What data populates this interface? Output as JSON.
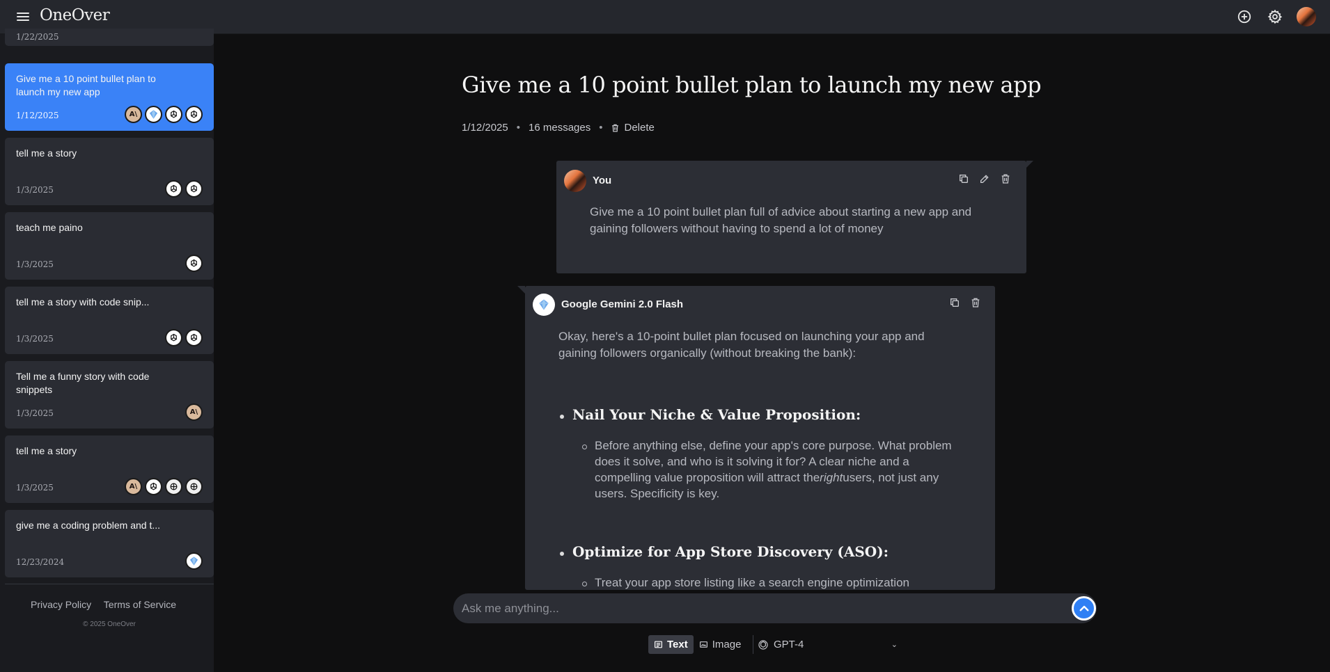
{
  "app": {
    "brand": "OneOver"
  },
  "sidebar": {
    "chats": [
      {
        "title": "",
        "date": "1/22/2025",
        "models": []
      },
      {
        "title": "Give me a 10 point bullet plan to launch my new app",
        "date": "1/12/2025",
        "models": [
          "anthropic-icon",
          "gemini-icon",
          "openai-icon",
          "openai-icon"
        ],
        "active": true
      },
      {
        "title": "tell me a story",
        "date": "1/3/2025",
        "models": [
          "openai-icon",
          "openai-icon"
        ]
      },
      {
        "title": "teach me paino",
        "date": "1/3/2025",
        "models": [
          "openai-icon"
        ]
      },
      {
        "title": "tell me a story with code snip...",
        "date": "1/3/2025",
        "models": [
          "openai-icon",
          "openai-icon"
        ]
      },
      {
        "title": "Tell me a funny story with code snippets",
        "date": "1/3/2025",
        "models": [
          "anthropic-icon"
        ]
      },
      {
        "title": "tell me a story",
        "date": "1/3/2025",
        "models": [
          "anthropic-icon",
          "openai-icon",
          "openai-alt-icon",
          "openai-alt-icon"
        ]
      },
      {
        "title": "give me a coding problem and t...",
        "date": "12/23/2024",
        "models": [
          "gemini-icon"
        ]
      }
    ],
    "footer": {
      "privacy": "Privacy Policy",
      "terms": "Terms of Service",
      "copyright": "© 2025 OneOver"
    }
  },
  "conversation": {
    "title": "Give me a 10 point bullet plan to launch my new app",
    "date": "1/12/2025",
    "message_count": "16 messages",
    "delete_label": "Delete",
    "user_message": {
      "sender": "You",
      "text": "Give me a 10 point bullet plan full of advice about starting a new app and gaining followers without having to spend a lot of money"
    },
    "ai_message": {
      "sender": "Google Gemini 2.0 Flash",
      "intro": "Okay, here's a 10-point bullet plan focused on launching your app and gaining followers organically (without breaking the bank):",
      "points": [
        {
          "heading": "Nail Your Niche & Value Proposition:",
          "detail_before": "Before anything else, define your app's core purpose. What problem does it solve, and who is it solving it for? A clear niche and a compelling value proposition will attract the",
          "detail_em": "right",
          "detail_after": "users, not just any users. Specificity is key."
        },
        {
          "heading": "Optimize for App Store Discovery (ASO):",
          "detail_before": "Treat your app store listing like a search engine optimization",
          "detail_em": "",
          "detail_after": ""
        }
      ]
    }
  },
  "composer": {
    "placeholder": "Ask me anything...",
    "modes": {
      "text": "Text",
      "image": "Image"
    },
    "model": "GPT-4"
  },
  "colors": {
    "accent": "#3a82f7",
    "send": "#2f7ff4",
    "card": "#2a2c33",
    "panel": "#2c2e35"
  }
}
